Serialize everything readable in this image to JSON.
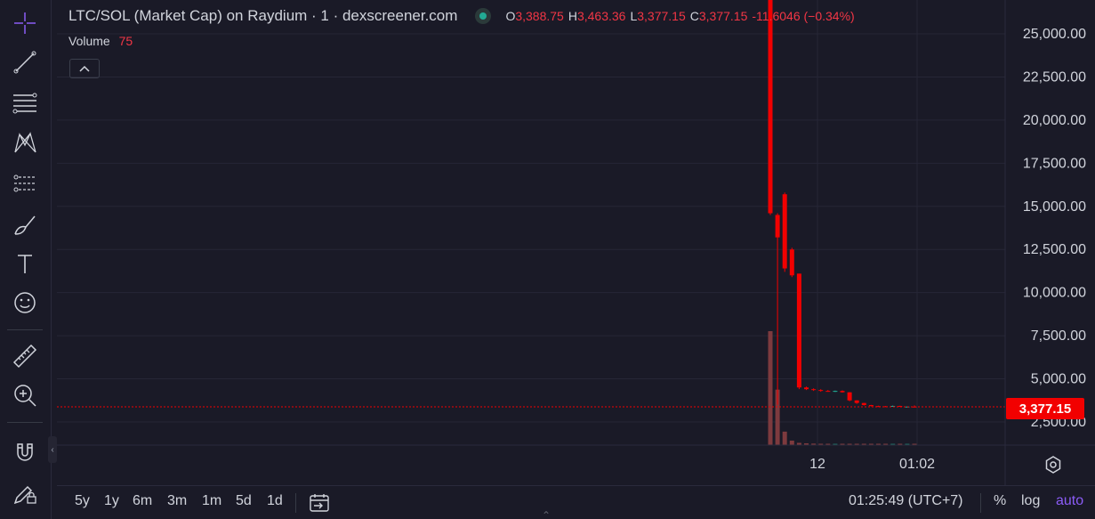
{
  "legend": {
    "title": "LTC/SOL (Market Cap) on Raydium · 1 · dexscreener.com",
    "o_label": "O",
    "o_value": "3,388.75",
    "h_label": "H",
    "h_value": "3,463.36",
    "l_label": "L",
    "l_value": "3,377.15",
    "c_label": "C",
    "c_value": "3,377.15",
    "change": "-11.6046 (−0.34%)"
  },
  "volume_legend": {
    "label": "Volume",
    "value": "75"
  },
  "price_axis": {
    "ticks": [
      "25,000.00",
      "22,500.00",
      "20,000.00",
      "17,500.00",
      "15,000.00",
      "12,500.00",
      "10,000.00",
      "7,500.00",
      "5,000.00",
      "2,500.00"
    ],
    "last_price": "3,377.15"
  },
  "time_axis": {
    "ticks": [
      "12",
      "01:02"
    ]
  },
  "bottom_bar": {
    "ranges": [
      "5y",
      "1y",
      "6m",
      "3m",
      "1m",
      "5d",
      "1d"
    ],
    "clock": "01:25:49 (UTC+7)",
    "percent": "%",
    "log": "log",
    "auto": "auto"
  },
  "colors": {
    "background": "#1a1a27",
    "grid": "#262636",
    "down": "#f20000",
    "up": "#22ab94",
    "volume_down": "#7d3a3e",
    "accent": "#8b5cf6",
    "text": "#d1d4dc"
  },
  "toolbar": {
    "tools": [
      "crosshair-icon",
      "trend-line-icon",
      "fib-icon",
      "pattern-icon",
      "prediction-icon",
      "brush-icon",
      "text-icon",
      "emoji-icon",
      "ruler-icon",
      "zoom-in-icon",
      "magnet-icon",
      "lock-drawings-icon"
    ]
  },
  "chart_data": {
    "type": "candlestick",
    "y_range": [
      0,
      26000
    ],
    "y_ticks": [
      2500,
      5000,
      7500,
      10000,
      12500,
      15000,
      17500,
      20000,
      22500,
      25000
    ],
    "x_ticks": [
      "12",
      "01:02"
    ],
    "grid": true,
    "last_price": 3377.15,
    "candles": [
      {
        "o": 27000,
        "h": 27000,
        "l": 14500,
        "c": 14600
      },
      {
        "o": 14500,
        "h": 14600,
        "l": 3500,
        "c": 13200
      },
      {
        "o": 15700,
        "h": 15800,
        "l": 11200,
        "c": 11400
      },
      {
        "o": 12500,
        "h": 12600,
        "l": 10900,
        "c": 11000
      },
      {
        "o": 11100,
        "h": 11100,
        "l": 4400,
        "c": 4500
      },
      {
        "o": 4500,
        "h": 4550,
        "l": 4350,
        "c": 4400
      },
      {
        "o": 4400,
        "h": 4450,
        "l": 4300,
        "c": 4350
      },
      {
        "o": 4350,
        "h": 4400,
        "l": 4250,
        "c": 4300
      },
      {
        "o": 4300,
        "h": 4350,
        "l": 4250,
        "c": 4250
      },
      {
        "o": 4250,
        "h": 4320,
        "l": 4240,
        "c": 4300
      },
      {
        "o": 4300,
        "h": 4330,
        "l": 4200,
        "c": 4220
      },
      {
        "o": 4220,
        "h": 4230,
        "l": 3700,
        "c": 3750
      },
      {
        "o": 3750,
        "h": 3760,
        "l": 3550,
        "c": 3600
      },
      {
        "o": 3600,
        "h": 3610,
        "l": 3450,
        "c": 3480
      },
      {
        "o": 3480,
        "h": 3490,
        "l": 3400,
        "c": 3420
      },
      {
        "o": 3420,
        "h": 3440,
        "l": 3390,
        "c": 3410
      },
      {
        "o": 3410,
        "h": 3430,
        "l": 3390,
        "c": 3400
      },
      {
        "o": 3400,
        "h": 3450,
        "l": 3395,
        "c": 3430
      },
      {
        "o": 3430,
        "h": 3440,
        "l": 3380,
        "c": 3390
      },
      {
        "o": 3390,
        "h": 3400,
        "l": 3380,
        "c": 3390
      },
      {
        "o": 3390,
        "h": 3463,
        "l": 3377,
        "c": 3377
      }
    ],
    "volume": [
      7600,
      3700,
      900,
      300,
      150,
      120,
      100,
      90,
      80,
      70,
      80,
      90,
      70,
      60,
      50,
      50,
      40,
      60,
      50,
      40,
      75
    ]
  }
}
